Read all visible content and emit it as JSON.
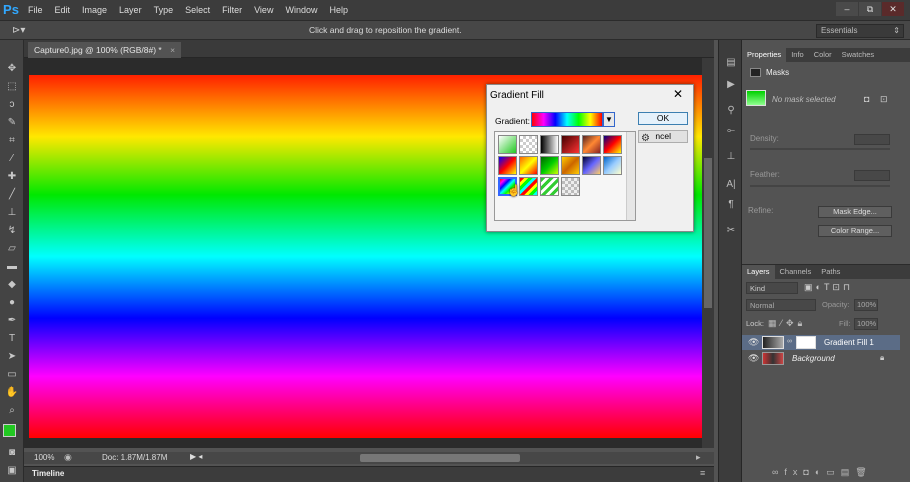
{
  "app": {
    "logo": "Ps"
  },
  "menu": [
    "File",
    "Edit",
    "Image",
    "Layer",
    "Type",
    "Select",
    "Filter",
    "View",
    "Window",
    "Help"
  ],
  "window_controls": {
    "minimize": "–",
    "restore": "⧉",
    "close": "✕"
  },
  "options_bar": {
    "hint": "Click and drag to reposition the gradient.",
    "workspace": "Essentials"
  },
  "document": {
    "tab_title": "Capture0.jpg @ 100% (RGB/8#) *",
    "close": "×",
    "zoom": "100%",
    "doc_size": "Doc: 1.87M/1.87M"
  },
  "timeline": {
    "label": "Timeline"
  },
  "properties": {
    "tabs": [
      "Properties",
      "Info",
      "Color",
      "Swatches"
    ],
    "section": "Masks",
    "mask_status": "No mask selected",
    "density_label": "Density:",
    "feather_label": "Feather:",
    "refine_label": "Refine:",
    "mask_edge_button": "Mask Edge...",
    "color_range_button": "Color Range..."
  },
  "layers_panel": {
    "tabs": [
      "Layers",
      "Channels",
      "Paths"
    ],
    "kind": "Kind",
    "blend_mode": "Normal",
    "opacity_label": "Opacity:",
    "opacity": "100%",
    "lock_label": "Lock:",
    "fill_label": "Fill:",
    "fill": "100%",
    "layers": [
      {
        "name": "Gradient Fill 1",
        "selected": true
      },
      {
        "name": "Background",
        "selected": false
      }
    ]
  },
  "dialog": {
    "title": "Gradient Fill",
    "gradient_label": "Gradient:",
    "ok": "OK",
    "cancel_partial": "ncel",
    "close": "✕"
  },
  "colors": {
    "ui_dark": "#3c3c3c",
    "panel": "#535353",
    "accent_blue": "#31a8ff",
    "selected_layer": "#5b6c86"
  }
}
